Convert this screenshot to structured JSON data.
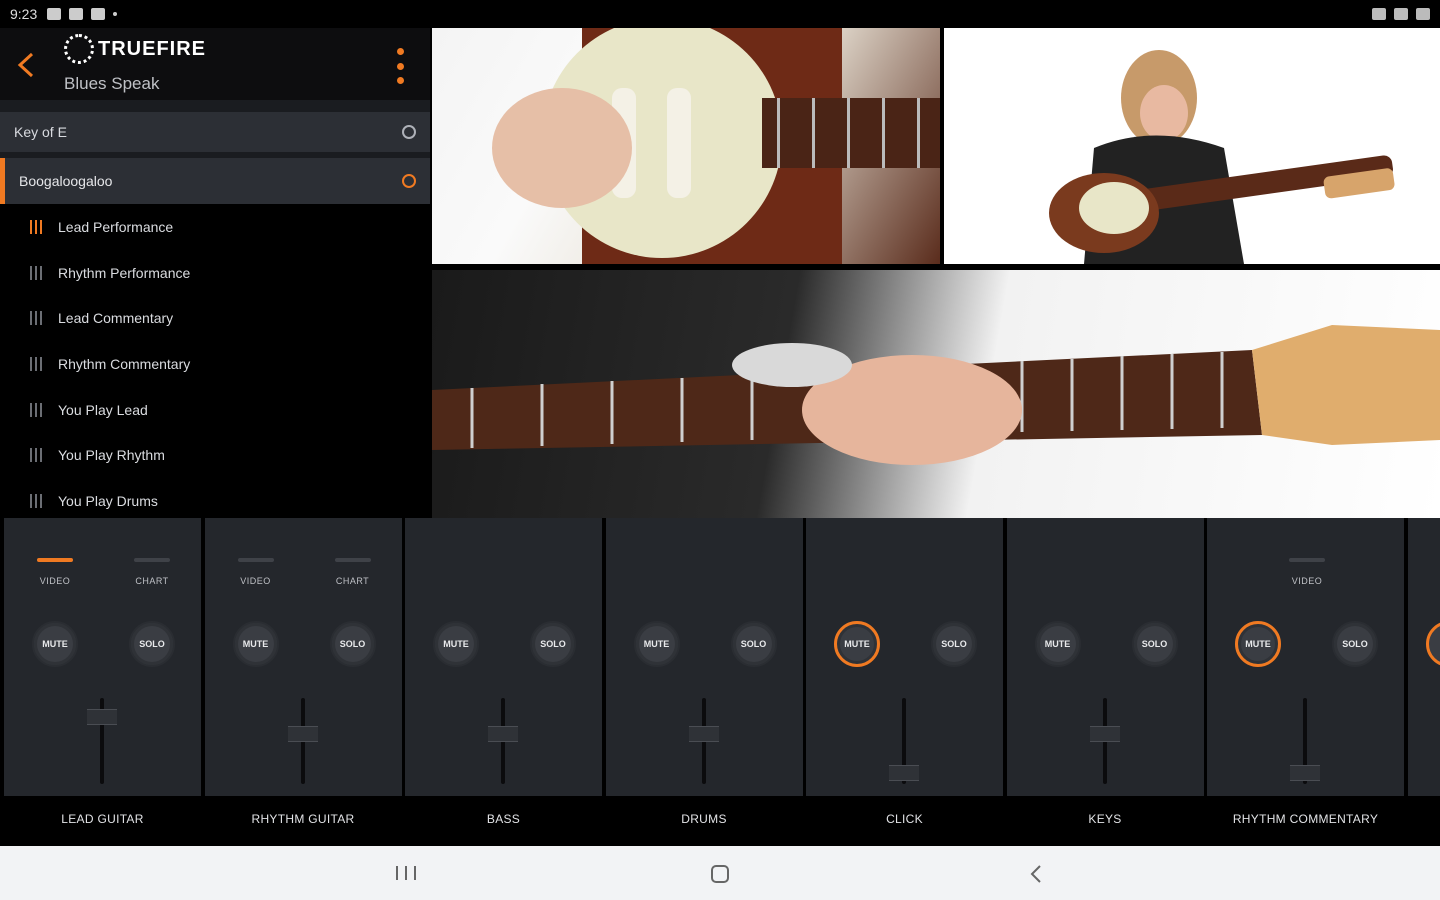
{
  "status_bar": {
    "time": "9:23"
  },
  "header": {
    "logo_text": "TRUEFIRE",
    "subtitle": "Blues Speak"
  },
  "key_row": {
    "label": "Key of E"
  },
  "song_row": {
    "label": "Boogaloogaloo"
  },
  "tracks": [
    {
      "label": "Lead Performance",
      "active": true
    },
    {
      "label": "Rhythm Performance",
      "active": false
    },
    {
      "label": "Lead Commentary",
      "active": false
    },
    {
      "label": "Rhythm Commentary",
      "active": false
    },
    {
      "label": "You Play Lead",
      "active": false
    },
    {
      "label": "You Play Rhythm",
      "active": false
    },
    {
      "label": "You Play Drums",
      "active": false
    }
  ],
  "mixer": {
    "mute_label": "MUTE",
    "solo_label": "SOLO",
    "video_label": "VIDEO",
    "chart_label": "CHART",
    "channels": [
      {
        "name": "LEAD GUITAR",
        "video": true,
        "chart": true,
        "video_on": true,
        "mute_active": false,
        "fader_level": 0.85
      },
      {
        "name": "RHYTHM GUITAR",
        "video": true,
        "chart": true,
        "video_on": false,
        "mute_active": false,
        "fader_level": 0.6
      },
      {
        "name": "BASS",
        "video": false,
        "chart": false,
        "video_on": false,
        "mute_active": false,
        "fader_level": 0.6
      },
      {
        "name": "DRUMS",
        "video": false,
        "chart": false,
        "video_on": false,
        "mute_active": false,
        "fader_level": 0.6
      },
      {
        "name": "CLICK",
        "video": false,
        "chart": false,
        "video_on": false,
        "mute_active": true,
        "fader_level": 0.05
      },
      {
        "name": "KEYS",
        "video": false,
        "chart": false,
        "video_on": false,
        "mute_active": false,
        "fader_level": 0.6
      },
      {
        "name": "RHYTHM COMMENTARY",
        "video": true,
        "chart": false,
        "video_on": false,
        "mute_active": true,
        "fader_level": 0.05
      }
    ]
  },
  "colors": {
    "accent": "#f07a22",
    "panel": "#24272c",
    "row": "#2c2f35"
  }
}
